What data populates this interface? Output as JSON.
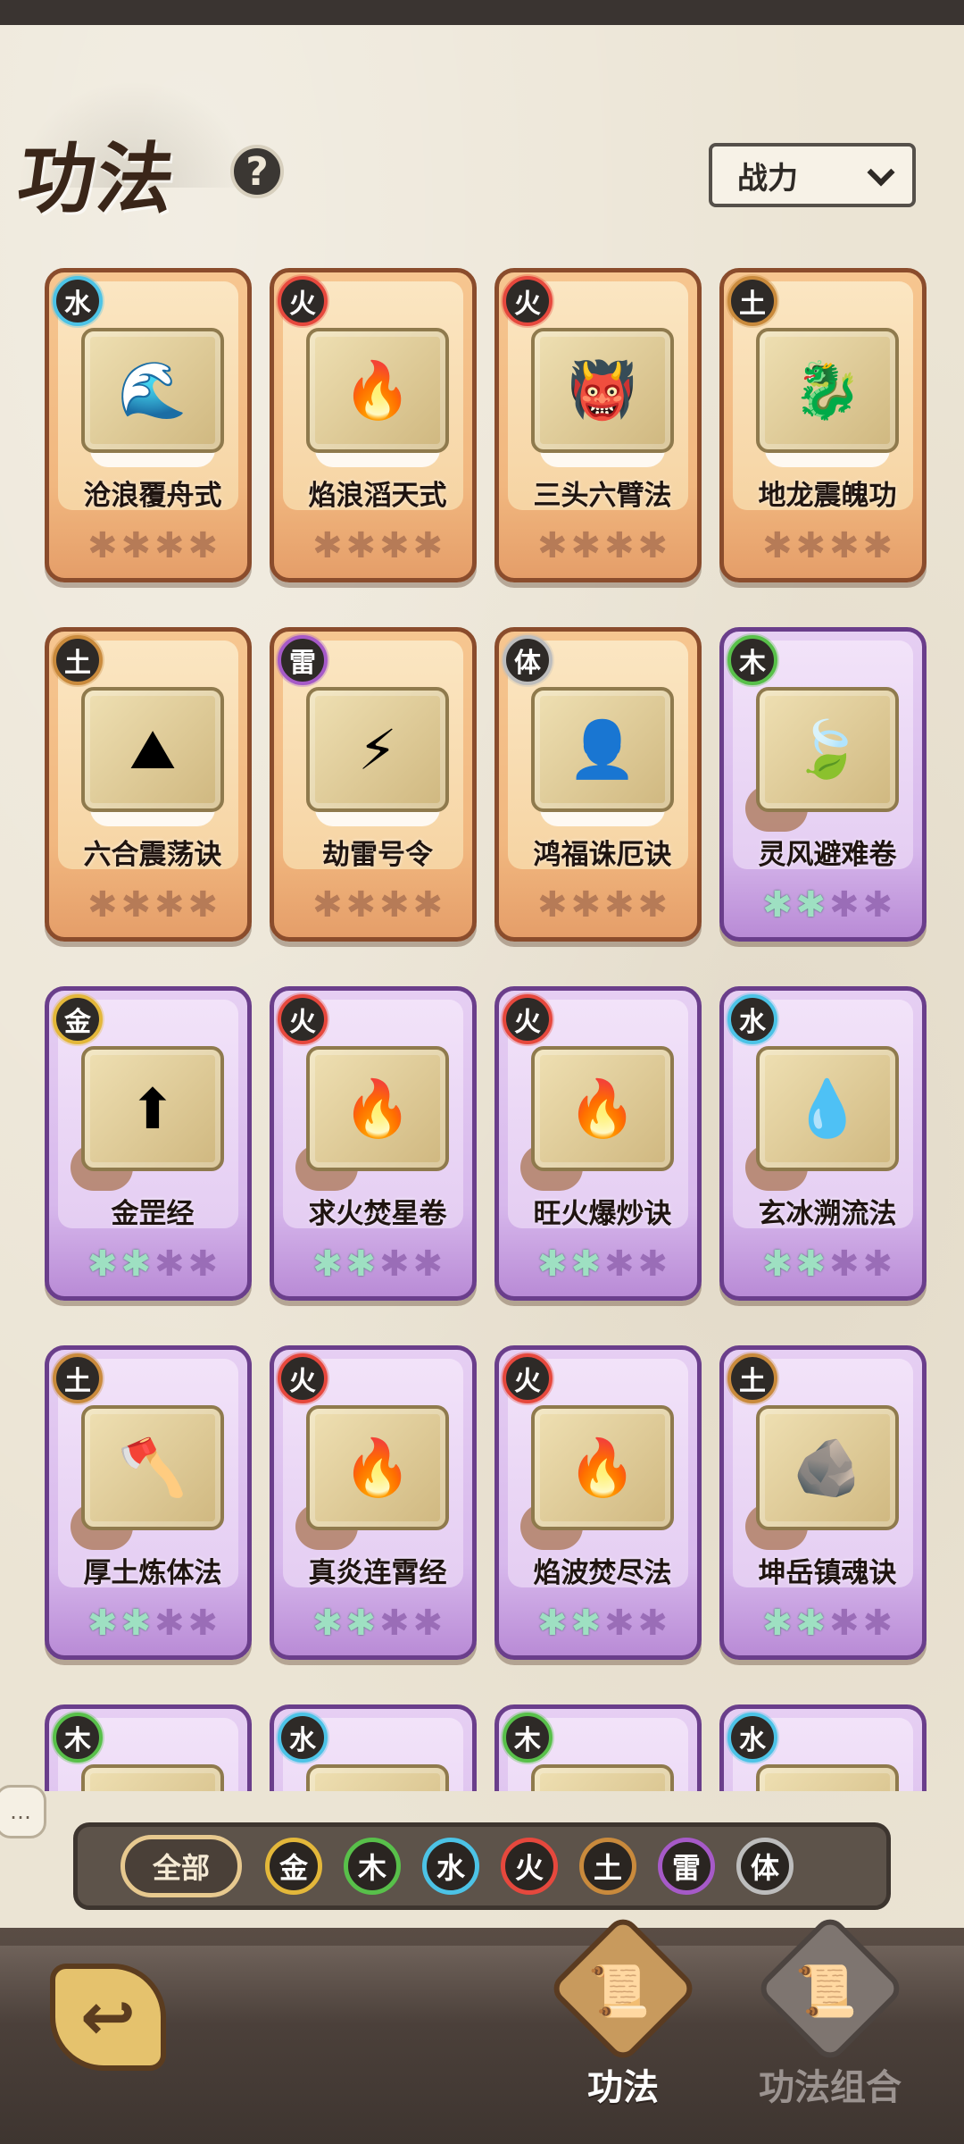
{
  "header": {
    "title": "功法",
    "help_icon": "?",
    "sort_label": "战力"
  },
  "element_colors": {
    "水": "#4cc3e6",
    "火": "#e6483d",
    "土": "#c98a3c",
    "雷": "#a65ac8",
    "体": "#bdbdbd",
    "木": "#58c04a",
    "金": "#e3b73a"
  },
  "cards": [
    {
      "name": "沧浪覆舟式",
      "element": "水",
      "rarity": "orange",
      "lit": 0,
      "art_icon": "🌊"
    },
    {
      "name": "焰浪滔天式",
      "element": "火",
      "rarity": "orange",
      "lit": 0,
      "art_icon": "🔥"
    },
    {
      "name": "三头六臂法",
      "element": "火",
      "rarity": "orange",
      "lit": 0,
      "art_icon": "👹"
    },
    {
      "name": "地龙震魄功",
      "element": "土",
      "rarity": "orange",
      "lit": 0,
      "art_icon": "🐉"
    },
    {
      "name": "六合震荡诀",
      "element": "土",
      "rarity": "orange",
      "lit": 0,
      "art_icon": "⛰"
    },
    {
      "name": "劫雷号令",
      "element": "雷",
      "rarity": "orange",
      "lit": 0,
      "art_icon": "⚡"
    },
    {
      "name": "鸿福诛厄诀",
      "element": "体",
      "rarity": "orange",
      "lit": 0,
      "art_icon": "👤"
    },
    {
      "name": "灵风避难卷",
      "element": "木",
      "rarity": "purple",
      "lit": 2,
      "art_icon": "🍃"
    },
    {
      "name": "金罡经",
      "element": "金",
      "rarity": "purple",
      "lit": 2,
      "art_icon": "⬆"
    },
    {
      "name": "求火焚星卷",
      "element": "火",
      "rarity": "purple",
      "lit": 2,
      "art_icon": "🔥"
    },
    {
      "name": "旺火爆炒诀",
      "element": "火",
      "rarity": "purple",
      "lit": 2,
      "art_icon": "🔥"
    },
    {
      "name": "玄冰溯流法",
      "element": "水",
      "rarity": "purple",
      "lit": 2,
      "art_icon": "💧"
    },
    {
      "name": "厚土炼体法",
      "element": "土",
      "rarity": "purple",
      "lit": 2,
      "art_icon": "🪓"
    },
    {
      "name": "真炎连霄经",
      "element": "火",
      "rarity": "purple",
      "lit": 2,
      "art_icon": "🔥"
    },
    {
      "name": "焰波焚尽法",
      "element": "火",
      "rarity": "purple",
      "lit": 2,
      "art_icon": "🔥"
    },
    {
      "name": "坤岳镇魂诀",
      "element": "土",
      "rarity": "purple",
      "lit": 2,
      "art_icon": "🪨"
    },
    {
      "name": "",
      "element": "木",
      "rarity": "purple",
      "lit": 0,
      "art_icon": ""
    },
    {
      "name": "",
      "element": "水",
      "rarity": "purple",
      "lit": 0,
      "art_icon": ""
    },
    {
      "name": "",
      "element": "木",
      "rarity": "purple",
      "lit": 0,
      "art_icon": ""
    },
    {
      "name": "",
      "element": "水",
      "rarity": "purple",
      "lit": 0,
      "art_icon": ""
    }
  ],
  "filters": {
    "all_label": "全部",
    "elements": [
      "金",
      "木",
      "水",
      "火",
      "土",
      "雷",
      "体"
    ]
  },
  "side_bubble": "…",
  "bottom_nav": {
    "back_icon": "back-arrow-icon",
    "items": [
      {
        "label": "功法",
        "active": true,
        "icon": "scroll-icon"
      },
      {
        "label": "功法组合",
        "active": false,
        "icon": "combo-scroll-icon"
      }
    ]
  }
}
